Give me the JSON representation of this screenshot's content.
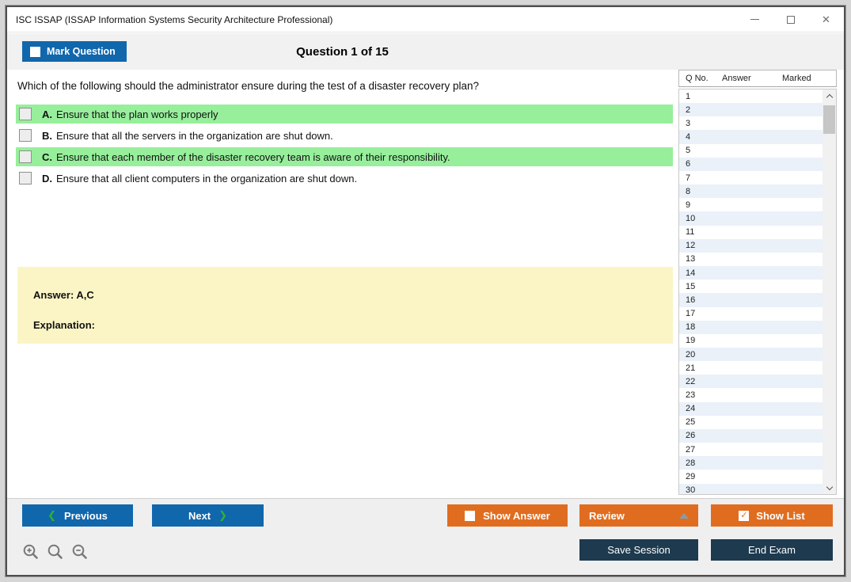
{
  "window": {
    "title": "ISC ISSAP (ISSAP Information Systems Security Architecture Professional)"
  },
  "header": {
    "mark_question_label": "Mark Question",
    "question_counter": "Question 1 of 15"
  },
  "question": {
    "text": "Which of the following should the administrator ensure during the test of a disaster recovery plan?",
    "options": [
      {
        "letter": "A.",
        "text": "Ensure that the plan works properly",
        "highlighted": true,
        "checked": false
      },
      {
        "letter": "B.",
        "text": "Ensure that all the servers in the organization are shut down.",
        "highlighted": false,
        "checked": false
      },
      {
        "letter": "C.",
        "text": "Ensure that each member of the disaster recovery team is aware of their responsibility.",
        "highlighted": true,
        "checked": false
      },
      {
        "letter": "D.",
        "text": "Ensure that all client computers in the organization are shut down.",
        "highlighted": false,
        "checked": false
      }
    ],
    "answer_label": "Answer: A,C",
    "explanation_label": "Explanation:"
  },
  "question_list": {
    "columns": [
      "Q No.",
      "Answer",
      "Marked"
    ],
    "rows": [
      {
        "q_no": "1",
        "answer": "",
        "marked": ""
      },
      {
        "q_no": "2",
        "answer": "",
        "marked": ""
      },
      {
        "q_no": "3",
        "answer": "",
        "marked": ""
      },
      {
        "q_no": "4",
        "answer": "",
        "marked": ""
      },
      {
        "q_no": "5",
        "answer": "",
        "marked": ""
      },
      {
        "q_no": "6",
        "answer": "",
        "marked": ""
      },
      {
        "q_no": "7",
        "answer": "",
        "marked": ""
      },
      {
        "q_no": "8",
        "answer": "",
        "marked": ""
      },
      {
        "q_no": "9",
        "answer": "",
        "marked": ""
      },
      {
        "q_no": "10",
        "answer": "",
        "marked": ""
      },
      {
        "q_no": "11",
        "answer": "",
        "marked": ""
      },
      {
        "q_no": "12",
        "answer": "",
        "marked": ""
      },
      {
        "q_no": "13",
        "answer": "",
        "marked": ""
      },
      {
        "q_no": "14",
        "answer": "",
        "marked": ""
      },
      {
        "q_no": "15",
        "answer": "",
        "marked": ""
      },
      {
        "q_no": "16",
        "answer": "",
        "marked": ""
      },
      {
        "q_no": "17",
        "answer": "",
        "marked": ""
      },
      {
        "q_no": "18",
        "answer": "",
        "marked": ""
      },
      {
        "q_no": "19",
        "answer": "",
        "marked": ""
      },
      {
        "q_no": "20",
        "answer": "",
        "marked": ""
      },
      {
        "q_no": "21",
        "answer": "",
        "marked": ""
      },
      {
        "q_no": "22",
        "answer": "",
        "marked": ""
      },
      {
        "q_no": "23",
        "answer": "",
        "marked": ""
      },
      {
        "q_no": "24",
        "answer": "",
        "marked": ""
      },
      {
        "q_no": "25",
        "answer": "",
        "marked": ""
      },
      {
        "q_no": "26",
        "answer": "",
        "marked": ""
      },
      {
        "q_no": "27",
        "answer": "",
        "marked": ""
      },
      {
        "q_no": "28",
        "answer": "",
        "marked": ""
      },
      {
        "q_no": "29",
        "answer": "",
        "marked": ""
      },
      {
        "q_no": "30",
        "answer": "",
        "marked": ""
      }
    ]
  },
  "footer": {
    "previous_label": "Previous",
    "next_label": "Next",
    "show_answer_label": "Show Answer",
    "review_label": "Review",
    "show_list_label": "Show List",
    "save_session_label": "Save Session",
    "end_exam_label": "End Exam",
    "show_list_checked": "✓",
    "prev_chevron": "❮",
    "next_chevron": "❯",
    "zoom_icons": [
      "zoom-in-icon",
      "zoom-reset-icon",
      "zoom-out-icon"
    ]
  },
  "colors": {
    "accent_blue": "#1167ac",
    "accent_orange": "#e06d1f",
    "navy": "#1d3a4f",
    "highlight_green": "#97ef9b",
    "answer_yellow": "#fbf5c6",
    "alt_row_blue": "#eaf1f9",
    "chevron_green": "#2db52d"
  }
}
